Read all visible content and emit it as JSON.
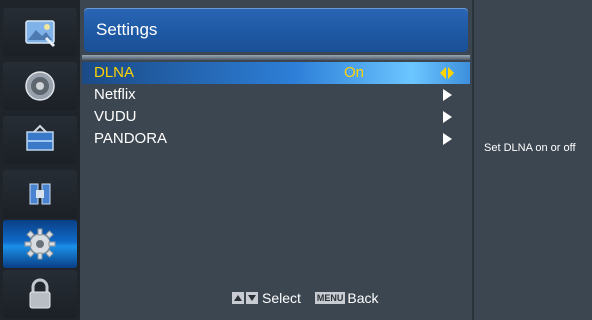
{
  "sidebar": {
    "items": [
      {
        "icon": "picture-icon",
        "active": false
      },
      {
        "icon": "speaker-icon",
        "active": false
      },
      {
        "icon": "channel-icon",
        "active": false
      },
      {
        "icon": "lock-shield-icon",
        "active": false
      },
      {
        "icon": "gear-icon",
        "active": true
      },
      {
        "icon": "lock-icon",
        "active": false
      }
    ]
  },
  "header": {
    "title": "Settings"
  },
  "menu": {
    "items": [
      {
        "label": "DLNA",
        "value": "On",
        "selected": true
      },
      {
        "label": "Netflix",
        "value": "",
        "selected": false
      },
      {
        "label": "VUDU",
        "value": "",
        "selected": false
      },
      {
        "label": "PANDORA",
        "value": "",
        "selected": false
      }
    ]
  },
  "footer": {
    "select_label": "Select",
    "menu_key": "MENU",
    "back_label": "Back"
  },
  "help": {
    "text": "Set DLNA on or off"
  },
  "colors": {
    "selected_text": "#ffd400",
    "header_blue": "#1f5aa6",
    "panel_bg": "#3c4650"
  }
}
